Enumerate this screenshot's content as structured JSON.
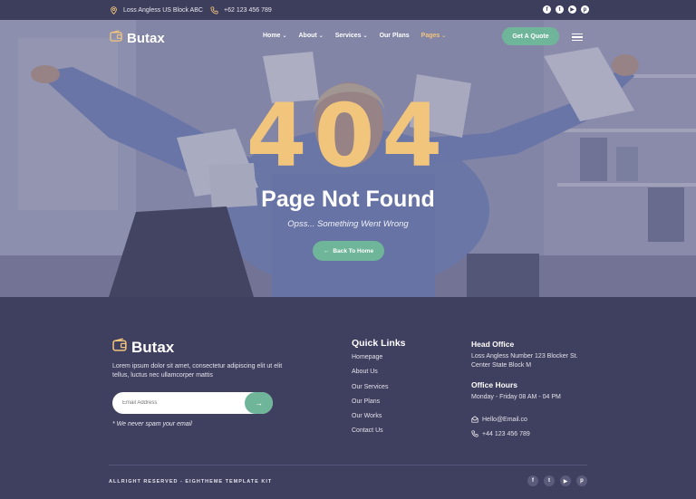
{
  "topbar": {
    "address": "Loss Angless US Block ABC",
    "phone": "+62 123 456 789",
    "social_icons": [
      "facebook-icon",
      "twitter-icon",
      "youtube-icon",
      "pinterest-icon"
    ]
  },
  "nav": {
    "brand": "Butax",
    "links": [
      {
        "label": "Home",
        "dropdown": true,
        "active": false
      },
      {
        "label": "About",
        "dropdown": true,
        "active": false
      },
      {
        "label": "Services",
        "dropdown": true,
        "active": false
      },
      {
        "label": "Our Plans",
        "dropdown": false,
        "active": false
      },
      {
        "label": "Pages",
        "dropdown": true,
        "active": true
      }
    ],
    "cta": "Get A Quote"
  },
  "hero": {
    "code": "404",
    "title": "Page Not Found",
    "subtitle": "Opss... Something Went Wrong",
    "button": "Back To Home"
  },
  "footer": {
    "brand": "Butax",
    "description": "Lorem ipsum dolor sit amet, consectetur adipiscing elit ut elit tellus, luctus nec ullamcorper mattis",
    "email_placeholder": "Email Address",
    "note": "* We never spam your email",
    "quick_links": {
      "title": "Quick Links",
      "items": [
        "Homepage",
        "About Us",
        "Our Services",
        "Our Plans",
        "Our Works",
        "Contact Us"
      ]
    },
    "head_office": {
      "title": "Head Office",
      "address": "Loss Angless Number 123 Blocker St. Center State Block M"
    },
    "office_hours": {
      "title": "Office Hours",
      "hours": "Monday - Friday 08 AM - 04 PM"
    },
    "email": "Hello@Email.co",
    "phone": "+44 123 456 789",
    "copyright": "ALLRIGHT RESERVED - EIGHTHEME TEMPLATE KIT",
    "social_icons": [
      "facebook-icon",
      "twitter-icon",
      "youtube-icon",
      "pinterest-icon"
    ]
  },
  "colors": {
    "navy": "#3f3f5f",
    "gold": "#f2c57c",
    "green": "#6fb59a"
  }
}
